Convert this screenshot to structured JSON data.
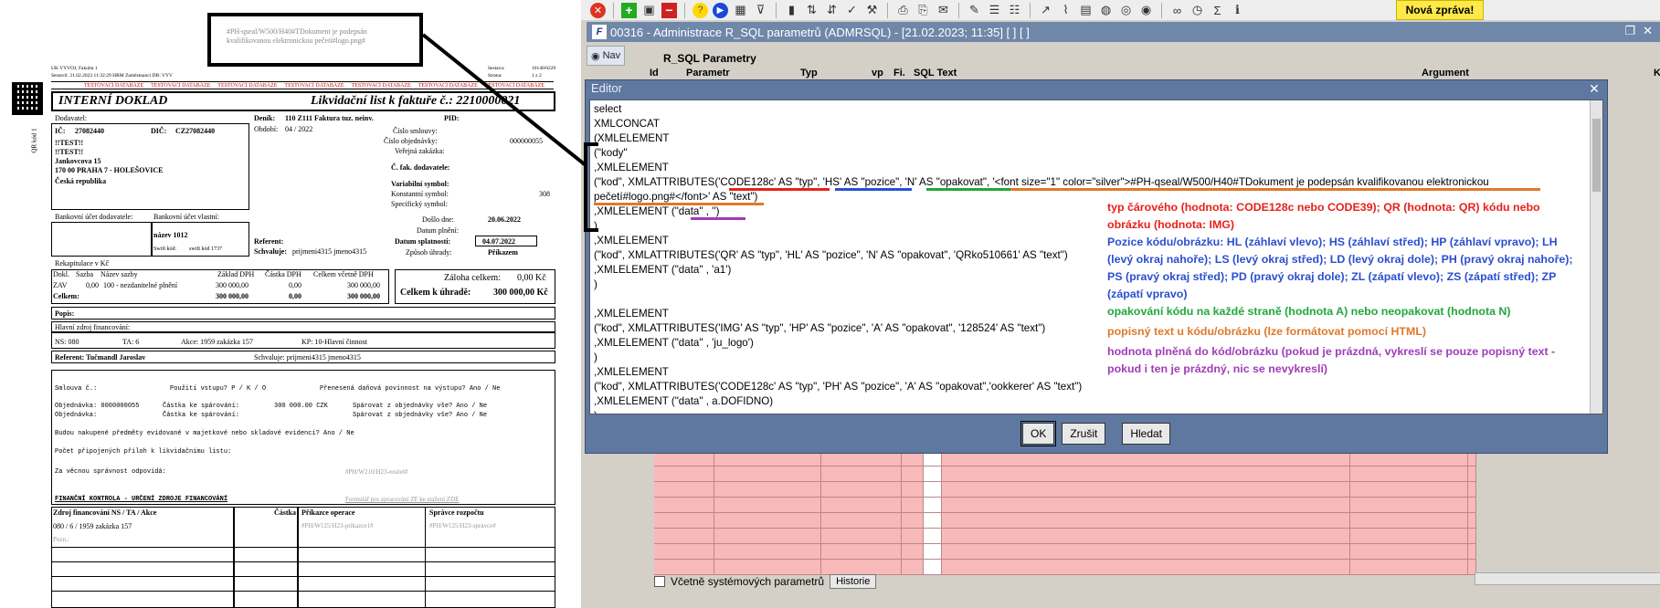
{
  "document": {
    "callout_text": "#PH-qseal/W500/H40#TDokument je podepsán kvalifikovanou elektronickou pečetí#logo.png#",
    "header_left_1": "UK VYVOJ, Fakulta 1",
    "header_left_2": "Sestavil: 21.02.2023 11:32:29 HRM Zaměstnanci  DB: VYV",
    "header_right_1": "Sestava:",
    "header_right_1_val": "10140/0229",
    "header_right_2": "Strana:",
    "header_right_2_val": "1 z 2",
    "test_labels": [
      "TESTOVACÍ DATABÁZE",
      "TESTOVACÍ DATABÁZE",
      "TESTOVACÍ DATABÁZE",
      "TESTOVACÍ DATABÁZE",
      "TESTOVACÍ DATABÁZE",
      "TESTOVACÍ DATABÁZE",
      "TESTOVACÍ DATABÁZE"
    ],
    "qr_label": "QR kód 1",
    "doc_type": "INTERNÍ DOKLAD",
    "doc_title": "Likvidační list k faktuře č.: 2210000021",
    "dodavatel_label": "Dodavatel:",
    "ic_label": "IČ:",
    "ic_val": "27082440",
    "dic_label": "DIČ:",
    "dic_val": "CZ27082440",
    "supplier_lines": [
      "!!TEST!!",
      "!!TEST!!",
      "Jankovcova 15",
      "170 00 PRAHA 7 - HOLEŠOVICE",
      "Česká republika"
    ],
    "denik_label": "Deník:",
    "denik_val": "110 Z111 Faktura tuz. neinv.",
    "obdobi_label": "Období:",
    "obdobi_val": "04 / 2022",
    "pid_label": "PID:",
    "cislo_smlouvy": "Číslo smlouvy:",
    "cislo_objednavky": "Číslo objednávky:",
    "cislo_objednavky_val": "000000055",
    "verejna_zakazka": "Veřejná zakázka:",
    "c_fak_dod": "Č. fak. dodavatele:",
    "variabilni": "Variabilní symbol:",
    "konstantni": "Konstantní symbol:",
    "konstantni_val": "308",
    "specificky": "Specifický symbol:",
    "doslo_dne": "Došlo dne:",
    "doslo_dne_val": "20.06.2022",
    "datum_plneni": "Datum plnění:",
    "datum_splatnosti": "Datum splatnosti:",
    "datum_splatnosti_val": "04.07.2022",
    "zpusob_uhrady": "Způsob úhrady:",
    "zpusob_uhrady_val": "Příkazem",
    "bank_dod_label": "Bankovní účet dodavatele:",
    "bank_vl_label": "Bankovní účet vlastní:",
    "bank_nazev": "název 1012",
    "swift_kod": "Swift kód:",
    "swift_val": "swift kód 1737",
    "referent_label": "Referent:",
    "schvaluje_label": "Schvaluje:",
    "schvaluje_val": "prijmeni4315 jmeno4315",
    "rekap_label": "Rekapitulace v Kč",
    "rekap_headers": [
      "Dokl.",
      "Sazba",
      "Název sazby",
      "Základ DPH",
      "Částka DPH",
      "Celkem včetně DPH"
    ],
    "rekap_row": [
      "ZAV",
      "0,00",
      "100 - nezdanitelné plnění",
      "300 000,00",
      "0,00",
      "300 000,00"
    ],
    "rekap_total": [
      "Celkem:",
      "300 000,00",
      "0,00",
      "300 000,00"
    ],
    "zaloha_label": "Záloha celkem:",
    "zaloha_val": "0,00 Kč",
    "uhrada_label": "Celkem k úhradě:",
    "uhrada_val": "300 000,00 Kč",
    "popis_label": "Popis:",
    "hlavni_zdroj": "Hlavní zdroj financování:",
    "ns": "NS: 080",
    "ta": "TA: 6",
    "akce": "Akce: 1959 zakázka 157",
    "kp": "KP: 10-Hlavní činnost",
    "referent_full": "Referent: Tučmandl Jaroslav",
    "schvaluje_full": "Schvaluje: prijmeni4315 jmeno4315",
    "smlouva_line": "Smlouva č.:",
    "pouziti": "Použití vstupu?  P / K / O",
    "prenesena": "Přenesená daňová povinnost na výstupu? Ano / Ne",
    "obj1": "Objednávka: 0000000055",
    "castka1": "Částka ke spárování:",
    "castka1_val": "300 000.00 CZK",
    "sparovat1": "Spárovat z objednávky vše? Ano / Ne",
    "obj2": "Objednávka:",
    "castka2": "Částka ke spárování:",
    "sparovat2": "Spárovat z objednávky vše? Ano / Ne",
    "budou": "Budou nakupené předměty evidované v majetkové nebo skladové evidenci?  Ano / Ne",
    "pocet": "Počet připojených příloh k likvidačnímu listu:",
    "za_vecnou": "Za věcnou správnost odpovídá:",
    "za_vecnou_tag": "#PH/W210/H23-resitel#",
    "fin_kontrola": "FINANČNÍ KONTROLA - URČENÍ ZDROJE FINANCOVÁNÍ",
    "formular": "Formulář pro zpracování ZF ke stažení ZDE",
    "zdroj_headers": [
      "Zdroj financování NS / TA / Akce",
      "Částka",
      "Příkazce operace",
      "Správce rozpočtu"
    ],
    "zdroj_row": "080 / 6 / 1959 zakázka 157",
    "prikazce_tag": "#PH/W125/H23-prikazce1#",
    "spravce_tag": "#PH/W125/H23-spravce#",
    "pozn": "Pozn.:"
  },
  "app": {
    "notification": "Nová zpráva!",
    "window_title": "00316 - Administrace R_SQL parametrů (ADMRSQL) - [21.02.2023; 11:35]  [ ]  [ ]",
    "nav_label": "Nav",
    "section_label": "R_SQL Parametry",
    "grid_headers": [
      "Id",
      "Parametr",
      "Typ",
      "vp",
      "Fi.",
      "SQL Text",
      "Argument",
      "K"
    ],
    "include_system": "Včetně systémových parametrů",
    "historie": "Historie",
    "editor": {
      "title": "Editor",
      "code": [
        "select",
        "XMLCONCAT",
        " (XMLELEMENT",
        "   (\"kody\"",
        "   ,XMLELEMENT",
        "     (\"kod\", XMLATTRIBUTES('CODE128c' AS \"typ\", 'HS' AS \"pozice\", 'N' AS \"opakovat\", '<font size=\"1\" color=\"silver\">#PH-qseal/W500/H40#TDokument je podepsán kvalifikovanou elektronickou",
        "pečetí#logo.png#</font>' AS \"text\")",
        "     ,XMLELEMENT (\"data\"   , '')",
        "     )",
        "  ,XMLELEMENT",
        "     (\"kod\", XMLATTRIBUTES('QR' AS \"typ\", 'HL' AS \"pozice\", 'N' AS \"opakovat\", 'QRko510661' AS \"text\")",
        "     ,XMLELEMENT (\"data\"   , 'a1')",
        "     )",
        "  ,XMLELEMENT",
        "     (\"kod\", XMLATTRIBUTES('IMG' AS \"typ\", 'HP' AS \"pozice\", 'A' AS \"opakovat\", '128524' AS \"text\")",
        "     ,XMLELEMENT (\"data\"   , 'ju_logo')",
        "     )",
        "  ,XMLELEMENT",
        "     (\"kod\", XMLATTRIBUTES('CODE128c' AS \"typ\", 'PH' AS \"pozice\", 'A' AS \"opakovat\",'ookkerer' AS \"text\")",
        "     ,XMLELEMENT (\"data\"   , a.DOFIDNO)",
        "     )",
        "  ,XMLELEMENT"
      ],
      "notes": [
        {
          "color": "#e8211a",
          "text": "typ čárového (hodnota: CODE128c nebo CODE39); QR (hodnota: QR) kódu nebo obrázku (hodnota: IMG)"
        },
        {
          "color": "#2b4fd0",
          "text": "Pozice kódu/obrázku: HL (záhlaví vlevo); HS (záhlaví střed); HP (záhlaví vpravo); LH (levý okraj nahoře); LS (levý okraj střed); LD (levý okraj dole); PH (pravý okraj nahoře); PS (pravý okraj střed); PD (pravý okraj dole); ZL (zápatí vlevo); ZS (zápatí střed); ZP (zápatí vpravo)"
        },
        {
          "color": "#1fa83a",
          "text": "opakování kódu na každé straně (hodnota A) nebo neopakovat (hodnota N)"
        },
        {
          "color": "#e0782a",
          "text": "popisný text u kódu/obrázku (lze formátovat pomocí HTML)"
        },
        {
          "color": "#a03cb8",
          "text": "hodnota plněná do kód/obrázku (pokud je prázdná, vykreslí se pouze popisný text - pokud i ten je prázdný, nic se nevykreslí)"
        }
      ],
      "buttons": {
        "ok": "OK",
        "cancel": "Zrušit",
        "search": "Hledat"
      }
    }
  }
}
